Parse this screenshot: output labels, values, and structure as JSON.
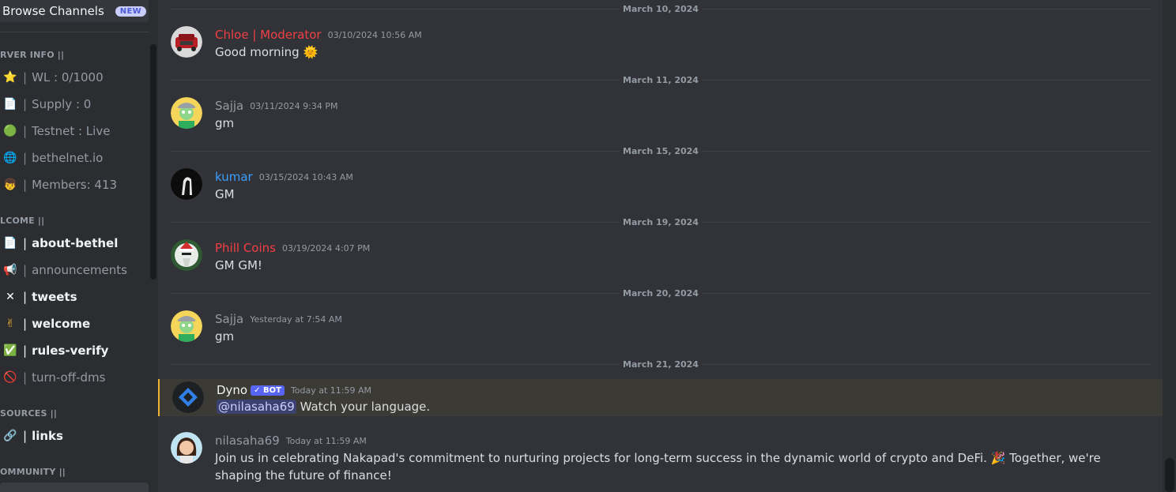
{
  "sidebar": {
    "browse": {
      "label": "Browse Channels",
      "badge": "NEW"
    },
    "categories": {
      "server_info": "RVER INFO ||",
      "welcome": "LCOME ||",
      "sources": "SOURCES ||",
      "community": "OMMUNITY ||"
    },
    "server_info_items": [
      {
        "icon": "⭐",
        "label": "WL : 0/1000"
      },
      {
        "icon": "📄",
        "label": "Supply : 0"
      },
      {
        "icon": "🟢",
        "label": "Testnet : Live"
      },
      {
        "icon": "🌐",
        "label": "bethelnet.io"
      },
      {
        "icon": "👦",
        "label": "Members: 413"
      }
    ],
    "welcome_items": [
      {
        "icon": "📄",
        "label": "about-bethel"
      },
      {
        "icon": "📢",
        "label": "announcements"
      },
      {
        "icon": "✕",
        "label": "tweets"
      },
      {
        "icon": "✌",
        "label": "welcome"
      },
      {
        "icon": "✅",
        "label": "rules-verify"
      },
      {
        "icon": "🚫",
        "label": "turn-off-dms"
      }
    ],
    "sources_items": [
      {
        "icon": "🔗",
        "label": "links"
      }
    ],
    "pipe": "|"
  },
  "chat": {
    "dates": [
      "March 10, 2024",
      "March 11, 2024",
      "March 15, 2024",
      "March 19, 2024",
      "March 20, 2024",
      "March 21, 2024"
    ],
    "messages": [
      {
        "author": "Chloe | Moderator",
        "time": "03/10/2024 10:56 AM",
        "text": "Good morning",
        "emoji": "🌞",
        "color": "#f23f43"
      },
      {
        "author": "Sajja",
        "time": "03/11/2024 9:34 PM",
        "text": "gm",
        "color": "#949ba4"
      },
      {
        "author": "kumar",
        "time": "03/15/2024 10:43 AM",
        "text": "GM",
        "color": "#3ba0ff"
      },
      {
        "author": "Phill Coins",
        "time": "03/19/2024 4:07 PM",
        "text": "GM GM!",
        "color": "#f23f43"
      },
      {
        "author": "Sajja",
        "time": "Yesterday at 7:54 AM",
        "text": "gm",
        "color": "#949ba4"
      },
      {
        "author": "Dyno",
        "bot": "✓ BOT",
        "time": "Today at 11:59 AM",
        "mention": "@nilasaha69",
        "text": "Watch your language.",
        "color": "#f2f3f5"
      },
      {
        "author": "nilasaha69",
        "time": "Today at 11:59 AM",
        "text": "Join us in celebrating Nakapad's commitment to nurturing projects for long-term success in the dynamic world of crypto and DeFi.",
        "emoji": "🎉",
        "text2": "Together, we're shaping the future of finance!",
        "color": "#949ba4"
      }
    ]
  }
}
